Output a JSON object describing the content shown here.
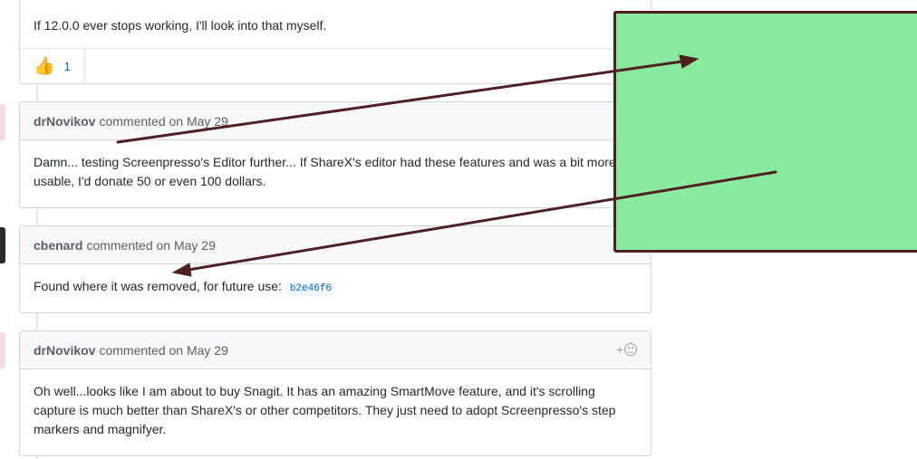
{
  "comments": [
    {
      "body": "If 12.0.0 ever stops working, I'll look into that myself.",
      "reaction": {
        "emoji": "👍",
        "count": "1"
      }
    },
    {
      "author": "drNovikov",
      "meta": "commented on May 29",
      "body": "Damn... testing Screenpresso's Editor further... If ShareX's editor had these features and was a bit more usable, I'd donate 50 or even 100 dollars."
    },
    {
      "author": "cbenard",
      "meta": "commented on May 29",
      "body_prefix": "Found where it was removed, for future use: ",
      "commit_sha": "b2e46f6"
    },
    {
      "author": "drNovikov",
      "meta": "commented on May 29",
      "add_reaction": "+",
      "body": "Oh well...looks like I am about to buy Snagit. It has an amazing SmartMove feature, and it's scrolling capture is much better than ShareX's or other competitors. They just need to adopt Screenpresso's step markers and magnifyer."
    }
  ],
  "colors": {
    "annotation_box": "#88ea9d",
    "annotation_stroke": "#4f1f22",
    "link": "#0366d6"
  }
}
